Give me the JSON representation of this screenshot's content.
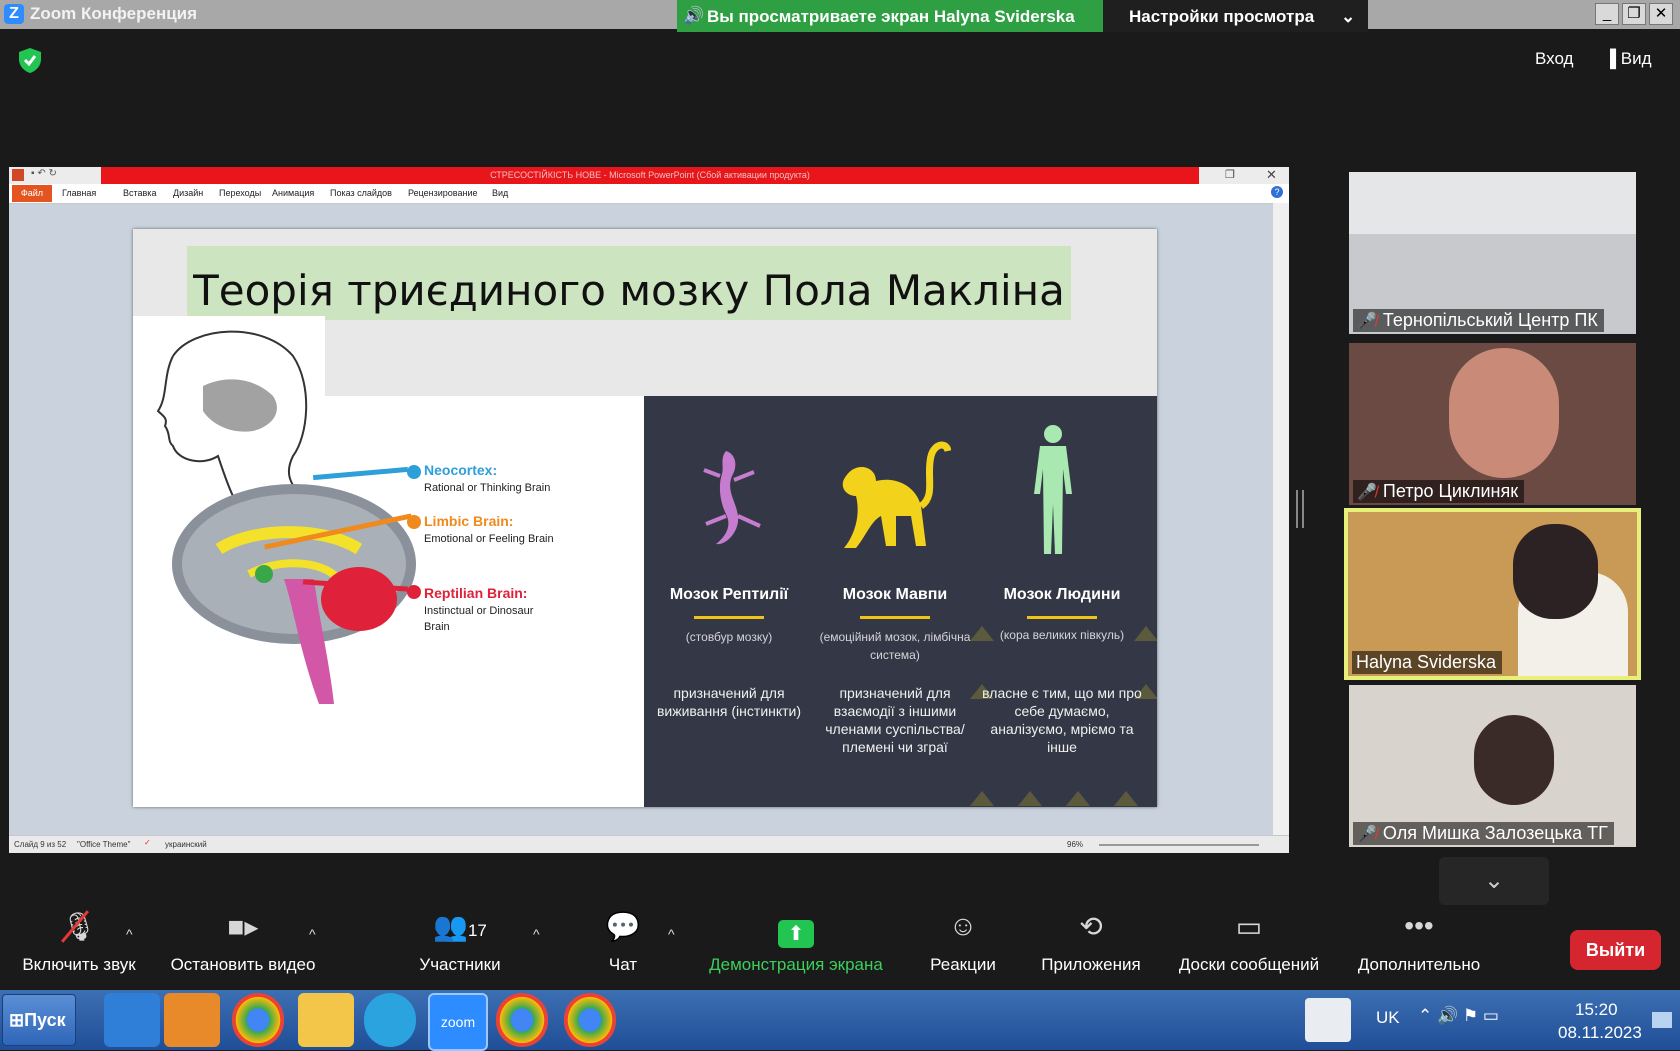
{
  "window": {
    "app_title": "Zoom Конференция",
    "share_banner": "Вы просматриваете экран Halyna Sviderska",
    "view_options": "Настройки просмотра",
    "top_right": {
      "enter": "Вход",
      "view": "Вид"
    }
  },
  "ppt": {
    "title": "СТРЕСОСТІЙКІСТЬ НОВЕ - Microsoft PowerPoint (Сбой активации продукта)",
    "tabs": [
      "Файл",
      "Главная",
      "Вставка",
      "Дизайн",
      "Переходы",
      "Анимация",
      "Показ слайдов",
      "Рецензирование",
      "Вид"
    ],
    "status": {
      "slide": "Слайд 9 из 52",
      "theme": "\"Office Theme\"",
      "lang": "украинский",
      "zoom": "96%"
    }
  },
  "slide": {
    "title": "Теорія триєдиного мозку Пола Макліна",
    "brain": [
      {
        "label": "Neocortex:",
        "desc": "Rational or Thinking Brain",
        "color": "#2d9fd9"
      },
      {
        "label": "Limbic Brain:",
        "desc": "Emotional or Feeling Brain",
        "color": "#f08a1c"
      },
      {
        "label": "Reptilian Brain:",
        "desc": "Instinctual or Dinosaur Brain",
        "color": "#e0213a"
      }
    ],
    "columns": [
      {
        "title": "Мозок Рептилії",
        "sub": "(стовбур мозку)",
        "desc": "призначений для виживання (інстинкти)",
        "icon": "lizard-icon",
        "color": "#c77dcf"
      },
      {
        "title": "Мозок Мавпи",
        "sub": "(емоційний мозок, лімбічна система)",
        "desc": "призначений для взаємодії з іншими членами суспільства/ племені чи зграї",
        "icon": "monkey-icon",
        "color": "#f3d21c"
      },
      {
        "title": "Мозок Людини",
        "sub": "(кора великих півкуль)",
        "desc": "власне є тим, що ми про себе думаємо, аналізуємо, мріємо та інше",
        "icon": "human-icon",
        "color": "#a9e8b0"
      }
    ]
  },
  "participants": [
    {
      "name": "Тернопільський Центр ПК",
      "muted": true,
      "bg": "#c7c9cc"
    },
    {
      "name": "Петро Циклиняк",
      "muted": true,
      "bg": "#6b4a44"
    },
    {
      "name": "Halyna Sviderska",
      "muted": false,
      "bg": "#c99a55",
      "active": true
    },
    {
      "name": "Оля Мишка Залозецька ТГ",
      "muted": true,
      "bg": "#d9d3cd"
    }
  ],
  "toolbar": {
    "audio": "Включить звук",
    "video": "Остановить видео",
    "participants": "Участники",
    "participants_count": "17",
    "chat": "Чат",
    "share": "Демонстрация экрана",
    "reactions": "Реакции",
    "apps": "Приложения",
    "whiteboards": "Доски сообщений",
    "more": "Дополнительно",
    "leave": "Выйти"
  },
  "taskbar": {
    "start": "Пуск",
    "lang": "UK",
    "time": "15:20",
    "date": "08.11.2023"
  }
}
